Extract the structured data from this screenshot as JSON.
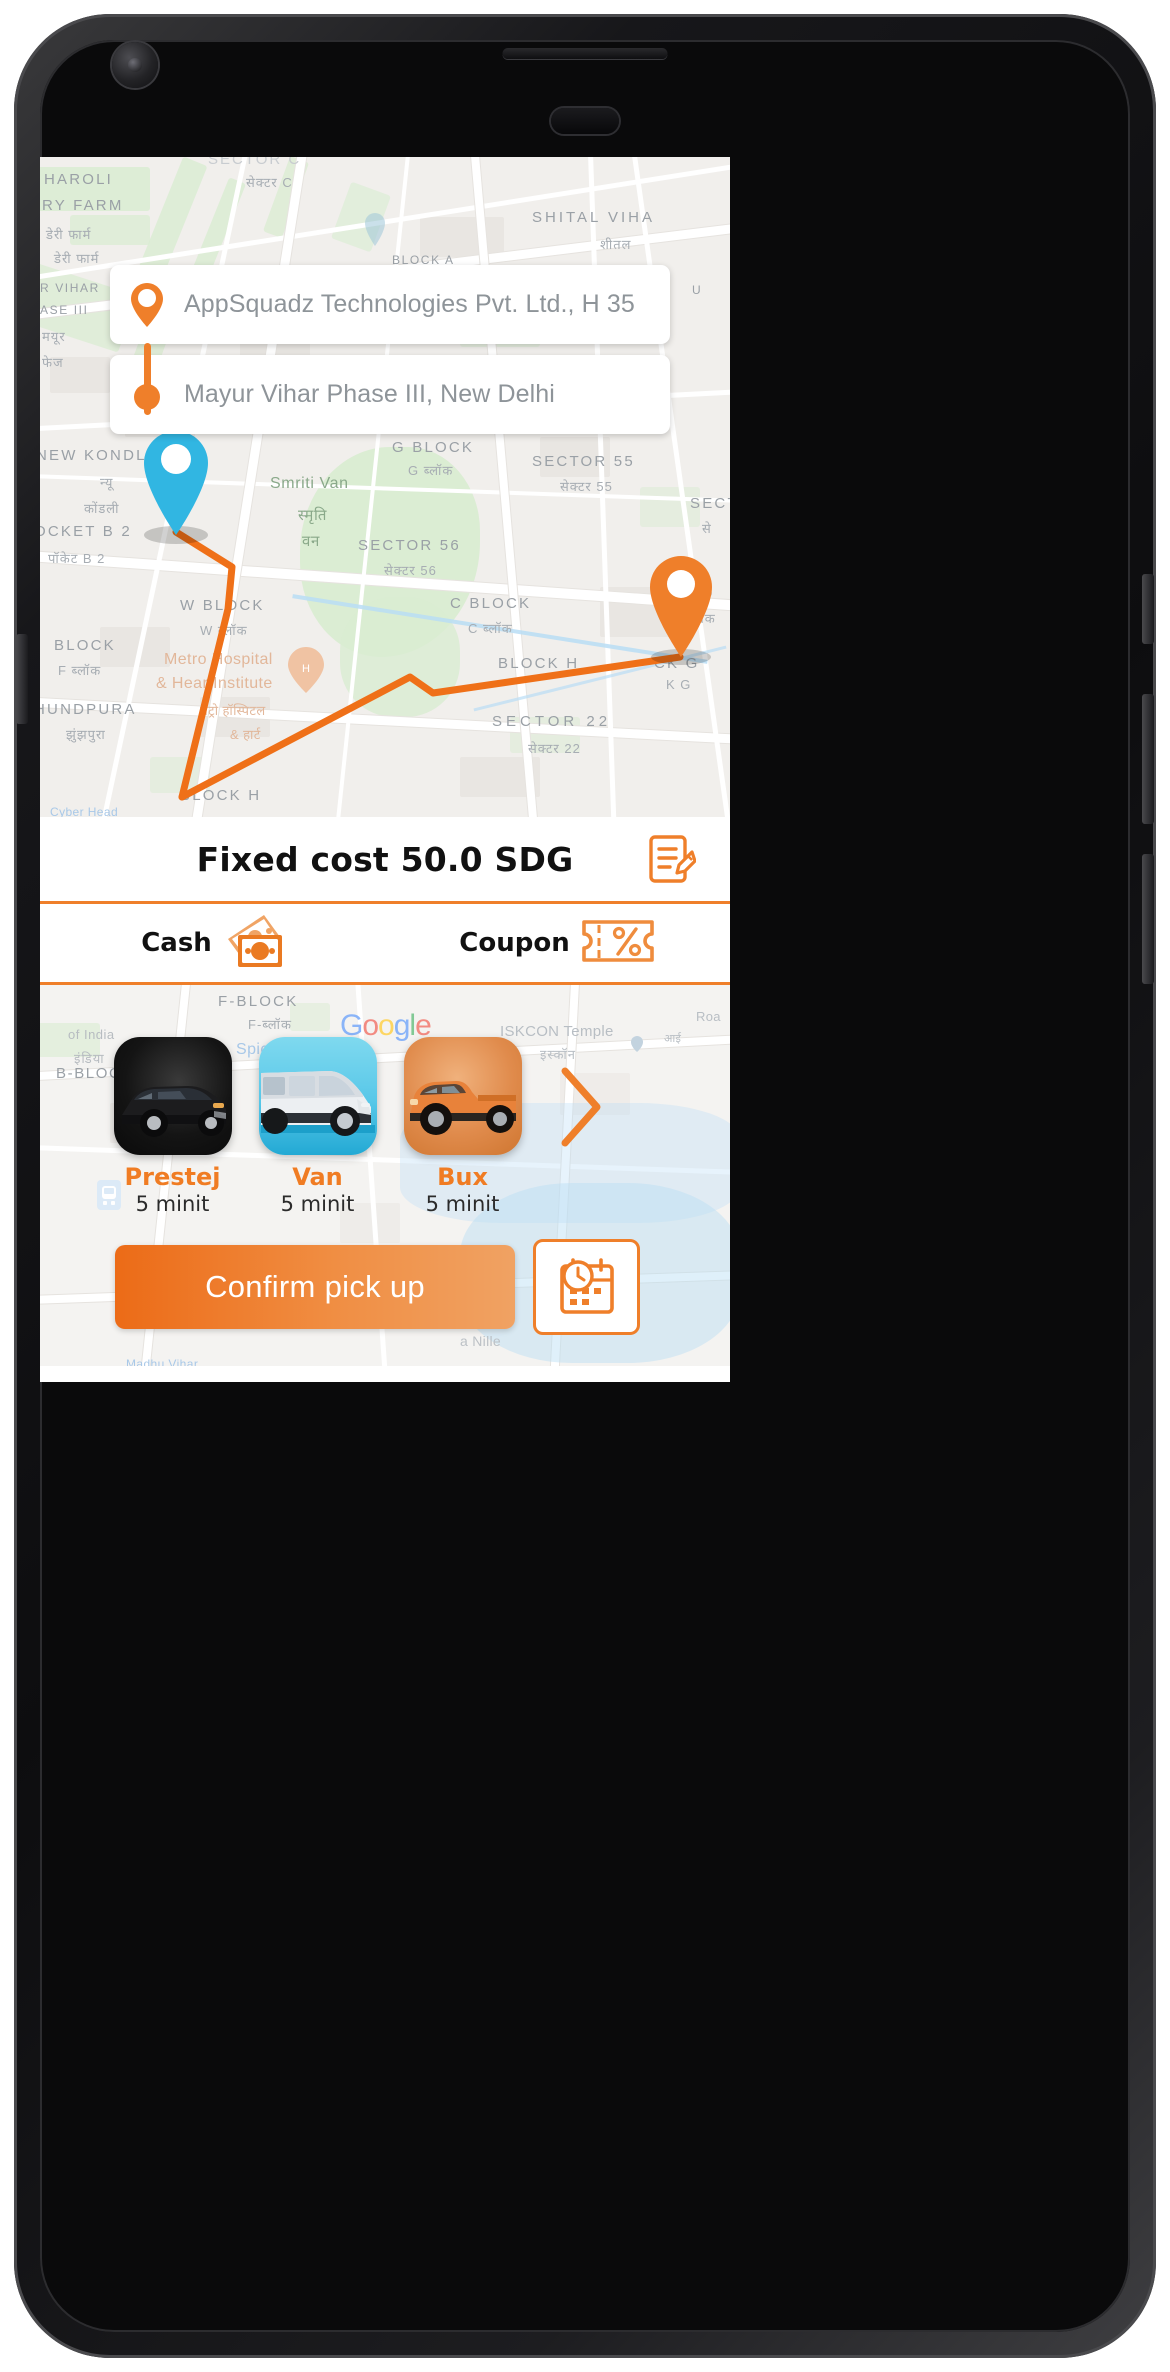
{
  "app": {
    "brand_color": "#ef7f2a",
    "accent_dark": "#ec6b17",
    "pin_pickup_color": "#29b6e0",
    "pin_dest_color": "#ef7f2a"
  },
  "addresses": {
    "pickup": {
      "text": "AppSquadz Technologies Pvt. Ltd., H 35",
      "icon": "map-pin-outline-icon"
    },
    "dropoff": {
      "text": "Mayur Vihar Phase III, New Delhi",
      "icon": "map-dot-icon"
    }
  },
  "fare": {
    "label": "Fixed cost 50.0 SDG",
    "edit_icon": "edit-note-icon"
  },
  "payment": {
    "options": [
      {
        "label": "Cash",
        "icon": "cash-money-icon"
      },
      {
        "label": "Coupon",
        "icon": "coupon-ticket-icon"
      }
    ]
  },
  "vehicles": {
    "items": [
      {
        "name": "Prestej",
        "eta": "5 minit",
        "selected": true
      },
      {
        "name": "Van",
        "eta": "5 minit",
        "selected": false
      },
      {
        "name": "Bux",
        "eta": "5 minit",
        "selected": false
      }
    ],
    "next_icon": "chevron-right-icon"
  },
  "actions": {
    "confirm_label": "Confirm pick up",
    "schedule_icon": "calendar-clock-icon"
  },
  "map": {
    "attribution": "Google",
    "labels": [
      {
        "text": "SECTOR C",
        "hi": "सेक्टर C"
      },
      {
        "text": "HAROLI",
        "hi": ""
      },
      {
        "text": "RY FARM",
        "hi": "डेरी फार्म"
      },
      {
        "text": "SHITAL VIHA",
        "hi": "शीतल"
      },
      {
        "text": "BLOCK A",
        "hi": ""
      },
      {
        "text": "R VIHAR",
        "hi": ""
      },
      {
        "text": "ASE III",
        "hi": ""
      },
      {
        "text": "NEW KONDLI",
        "hi": "न्यू कोंडली"
      },
      {
        "text": "Smriti Van",
        "hi": "स्मृति वन"
      },
      {
        "text": "G BLOCK",
        "hi": "G ब्लॉक"
      },
      {
        "text": "SECTOR 55",
        "hi": "सेक्टर 55"
      },
      {
        "text": "OCKET B 2",
        "hi": "पॉकेट B 2"
      },
      {
        "text": "SECTOR 56",
        "hi": "सेक्टर 56"
      },
      {
        "text": "W BLOCK",
        "hi": "W ब्लॉक"
      },
      {
        "text": "C BLOCK",
        "hi": "C ब्लॉक"
      },
      {
        "text": "BLOCK",
        "hi": "F ब्लॉक"
      },
      {
        "text": "Metro Hospital & Heart Institute",
        "hi": "मेट्रो हॉस्पिटल & हार्ट"
      },
      {
        "text": "HUNDPURA",
        "hi": "झुंझपुरा"
      },
      {
        "text": "BLOCK H",
        "hi": ""
      },
      {
        "text": "SECTOR 22",
        "hi": "सेक्टर 22"
      },
      {
        "text": "CK G",
        "hi": "K G"
      },
      {
        "text": "BLO",
        "hi": "ब्लॉक"
      },
      {
        "text": "SECT",
        "hi": "से"
      },
      {
        "text": "F-BLOCK",
        "hi": "F-ब्लॉक"
      },
      {
        "text": "B-BLOCK",
        "hi": ""
      },
      {
        "text": "Spice Cinemas",
        "hi": ""
      },
      {
        "text": "ISKCON Temple",
        "hi": "इस्कॉन"
      },
      {
        "text": "of India",
        "hi": "इंडिया"
      },
      {
        "text": "Roa",
        "hi": ""
      }
    ]
  }
}
